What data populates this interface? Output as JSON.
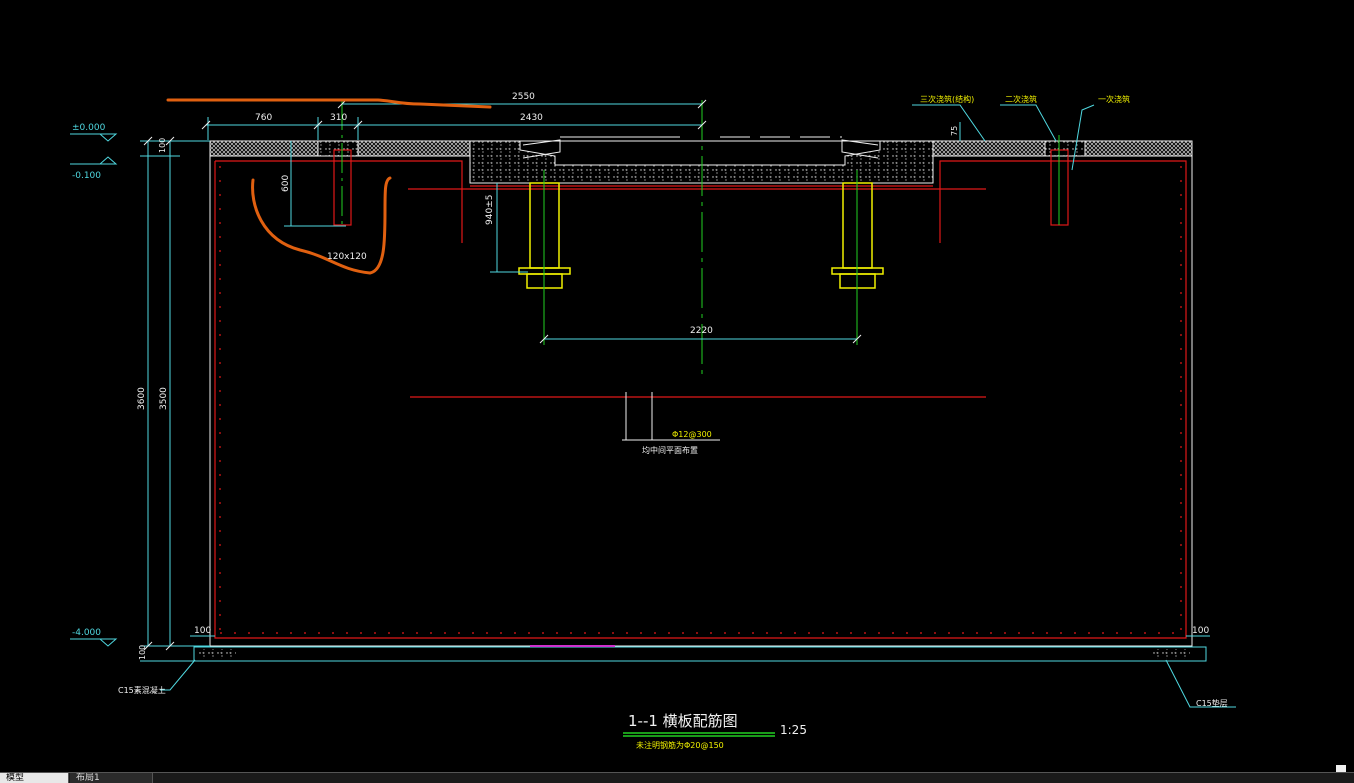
{
  "title": {
    "main": "1--1 横板配筋图",
    "scale": "1:25",
    "note": "未注明钢筋为Φ20@150"
  },
  "elevations": {
    "top": "±0.000",
    "second": "-0.100",
    "bottom": "-4.000"
  },
  "dimensions": {
    "d2550": "2550",
    "d760": "760",
    "d310": "310",
    "d2430": "2430",
    "d100_top": "100",
    "d600": "600",
    "d120x120": "120x120",
    "d940": "940±5",
    "d2220": "2220",
    "d3600": "3600",
    "d3500": "3500",
    "d100_left": "100",
    "d100_right": "100",
    "d100_bottom": "100",
    "d75": "75"
  },
  "labels": {
    "third_pour": "三次浇筑(结构)",
    "second_pour": "二次浇筑",
    "first_pour": "一次浇筑",
    "rebar": "Φ12@300",
    "rebar_desc": "均中间平面布置",
    "c15_left": "C15素混凝土",
    "c15_right": "C15垫层"
  },
  "tabs": [
    "模型",
    "布局1"
  ],
  "colors": {
    "red": "#e01818",
    "cyan": "#4fd8e0",
    "green": "#22d022",
    "yellow": "#f0f000",
    "white": "#f0f0f0",
    "orange": "#e06010",
    "magenta": "#d030d0"
  }
}
